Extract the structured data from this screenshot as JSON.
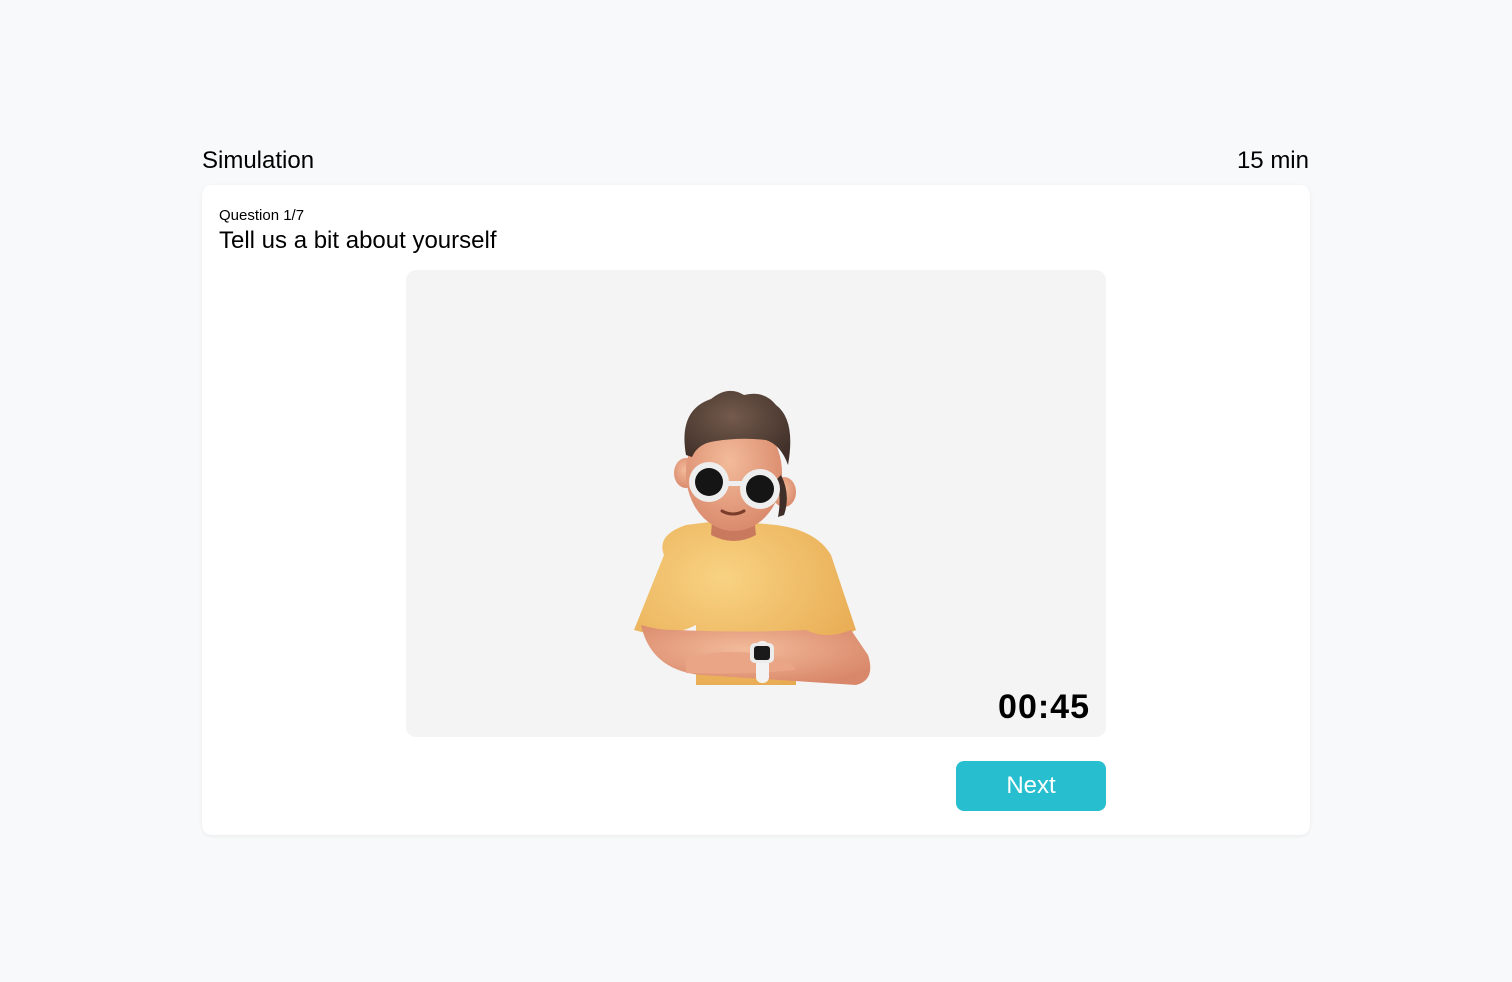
{
  "header": {
    "title": "Simulation",
    "duration": "15 min"
  },
  "question": {
    "counter": "Question 1/7",
    "text": "Tell us a bit about yourself"
  },
  "video": {
    "avatar_icon": "avatar-3d-person-icon",
    "timer": "00:45"
  },
  "actions": {
    "next_label": "Next"
  },
  "colors": {
    "accent": "#27bfcf",
    "page_background": "#f8f9fa",
    "video_background": "#f4f4f4"
  }
}
